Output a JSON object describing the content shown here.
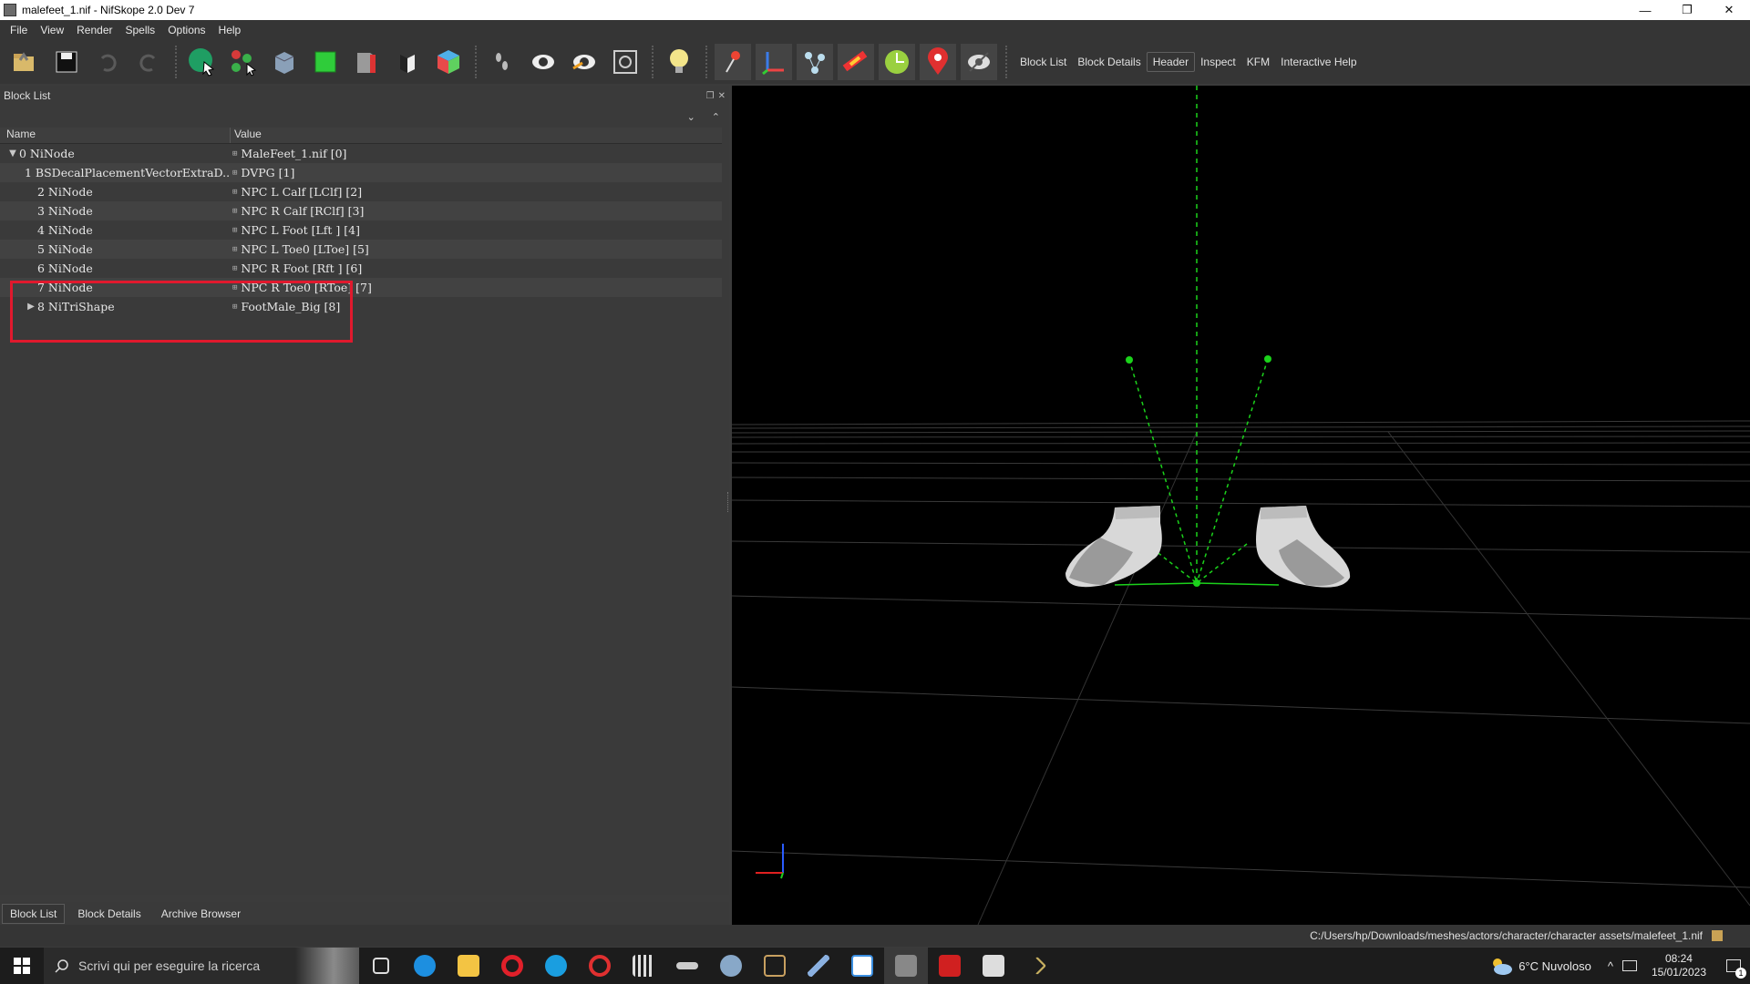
{
  "window": {
    "title": "malefeet_1.nif - NifSkope 2.0 Dev 7",
    "minimize": "—",
    "maximize": "❐",
    "close": "✕"
  },
  "menu": [
    "File",
    "View",
    "Render",
    "Spells",
    "Options",
    "Help"
  ],
  "toolbar": {
    "text_buttons": [
      "Block List",
      "Block Details",
      "Header",
      "Inspect",
      "KFM",
      "Interactive Help"
    ],
    "active_text_button": "Header"
  },
  "block_list": {
    "title": "Block List",
    "columns": {
      "name": "Name",
      "value": "Value"
    },
    "rows": [
      {
        "name": "0 NiNode",
        "value": "MaleFeet_1.nif [0]",
        "expander": "expanded",
        "indent": 0
      },
      {
        "name": "1 BSDecalPlacementVectorExtraD...",
        "value": "DVPG [1]",
        "expander": "none",
        "indent": 1
      },
      {
        "name": "2 NiNode",
        "value": "NPC L Calf [LClf] [2]",
        "expander": "none",
        "indent": 1
      },
      {
        "name": "3 NiNode",
        "value": "NPC R Calf [RClf] [3]",
        "expander": "none",
        "indent": 1
      },
      {
        "name": "4 NiNode",
        "value": "NPC L Foot [Lft ] [4]",
        "expander": "none",
        "indent": 1
      },
      {
        "name": "5 NiNode",
        "value": "NPC L Toe0 [LToe] [5]",
        "expander": "none",
        "indent": 1
      },
      {
        "name": "6 NiNode",
        "value": "NPC R Foot [Rft ] [6]",
        "expander": "none",
        "indent": 1
      },
      {
        "name": "7 NiNode",
        "value": "NPC R Toe0 [RToe] [7]",
        "expander": "none",
        "indent": 1
      },
      {
        "name": "8 NiTriShape",
        "value": "FootMale_Big [8]",
        "expander": "collapsed",
        "indent": 1
      }
    ]
  },
  "bottom_tabs": [
    "Block List",
    "Block Details",
    "Archive Browser"
  ],
  "active_bottom_tab": "Block List",
  "status_bar": {
    "path": "C:/Users/hp/Downloads/meshes/actors/character/character assets/malefeet_1.nif"
  },
  "taskbar": {
    "search_placeholder": "Scrivi qui per eseguire la ricerca",
    "weather": "6°C  Nuvoloso",
    "time": "08:24",
    "date": "15/01/2023",
    "notification_count": "1"
  },
  "colors": {
    "highlight_box": "#e0192d",
    "skeleton_green": "#1bd21b",
    "panel_bg": "#3a3a3a",
    "viewport_bg": "#000000"
  }
}
